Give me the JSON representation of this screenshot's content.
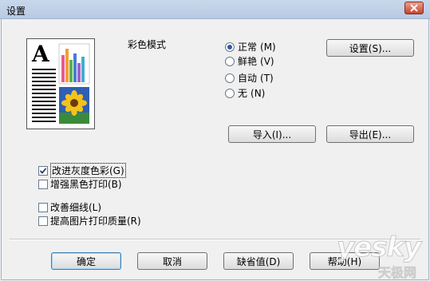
{
  "window": {
    "title": "设置"
  },
  "color_mode": {
    "label": "彩色模式",
    "options": [
      {
        "label": "正常",
        "mnemonic": "(M)",
        "selected": true
      },
      {
        "label": "鲜艳",
        "mnemonic": "(V)",
        "selected": false
      },
      {
        "label": "自动",
        "mnemonic": "(T)",
        "selected": false
      },
      {
        "label": "无",
        "mnemonic": "(N)",
        "selected": false
      }
    ],
    "settings_button": "设置(S)..."
  },
  "import_button": "导入(I)...",
  "export_button": "导出(E)...",
  "options": [
    {
      "label": "改进灰度色彩(G)",
      "checked": true,
      "focused": true
    },
    {
      "label": "增强黑色打印(B)",
      "checked": false,
      "focused": false
    },
    {
      "label": "改善细线(L)",
      "checked": false,
      "focused": false
    },
    {
      "label": "提高图片打印质量(R)",
      "checked": false,
      "focused": false
    }
  ],
  "buttons": {
    "ok": "确定",
    "cancel": "取消",
    "defaults": "缺省值(D)",
    "help": "帮助(H)"
  },
  "watermark": {
    "brand": "yesky",
    "sub": "天极网"
  }
}
